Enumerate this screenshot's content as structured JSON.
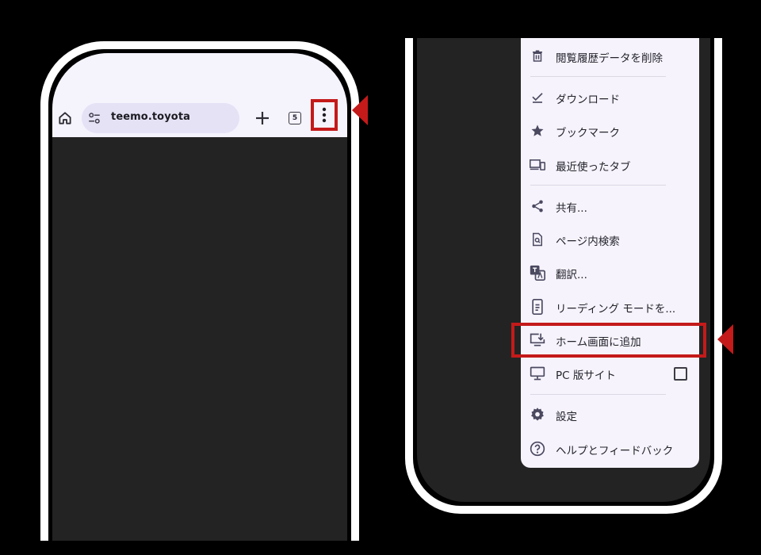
{
  "left_phone": {
    "url": "teemo.toyota",
    "tab_count": "5"
  },
  "menu": {
    "items": [
      {
        "label": "閲覧履歴データを削除",
        "icon": "trash-icon"
      },
      {
        "label": "ダウンロード",
        "icon": "download-done-icon"
      },
      {
        "label": "ブックマーク",
        "icon": "star-icon"
      },
      {
        "label": "最近使ったタブ",
        "icon": "devices-icon"
      },
      {
        "label": "共有...",
        "icon": "share-icon"
      },
      {
        "label": "ページ内検索",
        "icon": "find-in-page-icon"
      },
      {
        "label": "翻訳...",
        "icon": "translate-icon"
      },
      {
        "label": "リーディング モードを...",
        "icon": "reading-mode-icon"
      },
      {
        "label": "ホーム画面に追加",
        "icon": "add-to-home-icon"
      },
      {
        "label": "PC 版サイト",
        "icon": "desktop-icon"
      },
      {
        "label": "設定",
        "icon": "gear-icon"
      },
      {
        "label": "ヘルプとフィードバック",
        "icon": "help-icon"
      }
    ],
    "desktop_site_checked": false
  },
  "colors": {
    "highlight": "#c41a1a",
    "menu_bg": "#f6f3fc",
    "icon": "#4a4960"
  }
}
